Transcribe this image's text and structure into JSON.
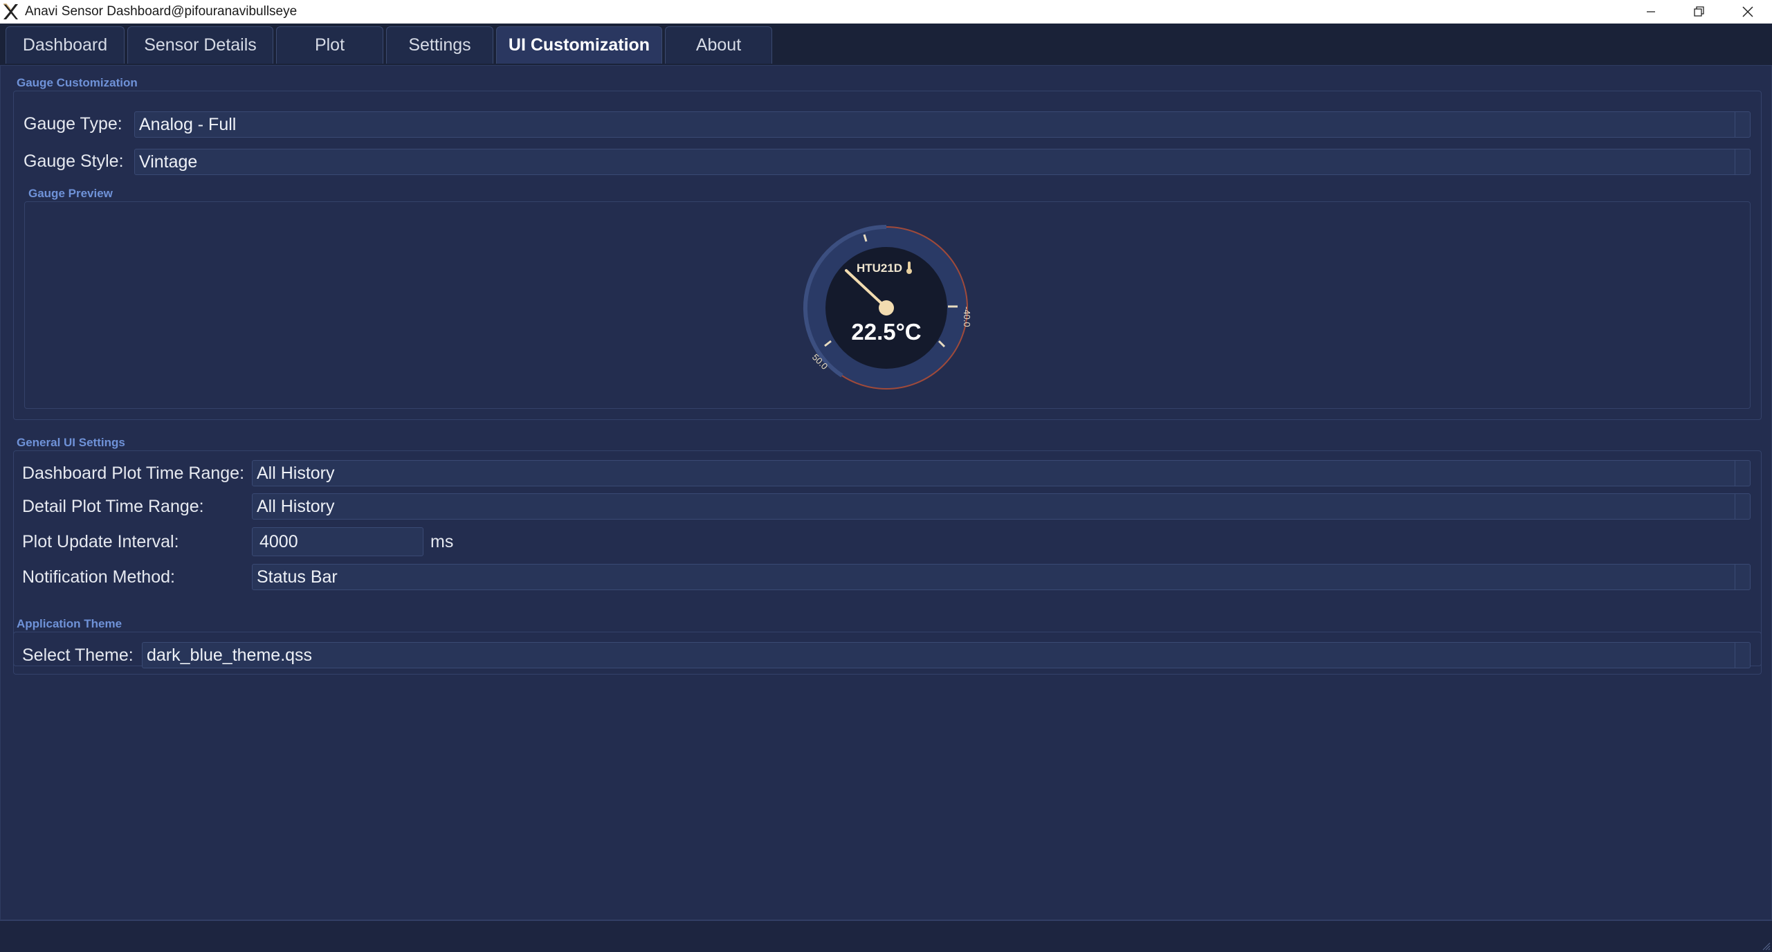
{
  "window": {
    "title": "Anavi Sensor Dashboard@pifouranavibullseye",
    "minimize_glyph": "—",
    "restore_glyph": "❐",
    "close_glyph": "✕"
  },
  "tabs": [
    {
      "label": "Dashboard"
    },
    {
      "label": "Sensor Details"
    },
    {
      "label": "Plot"
    },
    {
      "label": "Settings"
    },
    {
      "label": "UI Customization"
    },
    {
      "label": "About"
    }
  ],
  "gauge_customization": {
    "section_title": "Gauge Customization",
    "type_label": "Gauge Type:",
    "type_value": "Analog - Full",
    "style_label": "Gauge Style:",
    "style_value": "Vintage",
    "preview_title": "Gauge Preview",
    "preview": {
      "sensor_name": "HTU21D",
      "reading": "22.5°C",
      "min_tick": "50.0",
      "max_tick": "-40.0"
    }
  },
  "general_ui": {
    "section_title": "General UI Settings",
    "dashboard_range_label": "Dashboard Plot Time Range:",
    "dashboard_range_value": "All History",
    "detail_range_label": "Detail Plot Time Range:",
    "detail_range_value": "All History",
    "interval_label": "Plot Update Interval:",
    "interval_value": "4000",
    "interval_unit": "ms",
    "notification_label": "Notification Method:",
    "notification_value": "Status Bar"
  },
  "theme": {
    "section_title": "Application Theme",
    "select_label": "Select Theme:",
    "select_value": "dark_blue_theme.qss"
  },
  "colors": {
    "background": "#232d4f",
    "accent_title": "#6f92d8",
    "gauge_needle": "#f2dcb0",
    "gauge_ring": "#a04a3a"
  }
}
